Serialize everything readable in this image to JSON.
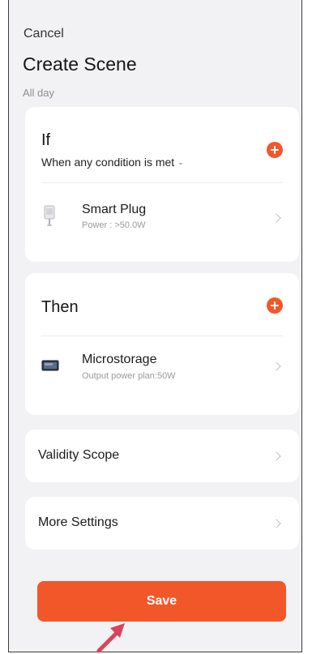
{
  "header": {
    "cancel_label": "Cancel",
    "title": "Create Scene",
    "subtitle": "All day"
  },
  "if_section": {
    "heading": "If",
    "condition_mode": "When any condition is met",
    "add_icon": "plus-circle-icon",
    "device": {
      "name": "Smart Plug",
      "detail": "Power : >50.0W",
      "icon": "smart-plug-icon"
    }
  },
  "then_section": {
    "heading": "Then",
    "add_icon": "plus-circle-icon",
    "device": {
      "name": "Microstorage",
      "detail": "Output power plan:50W",
      "icon": "microstorage-icon"
    }
  },
  "validity_scope_label": "Validity Scope",
  "more_settings_label": "More Settings",
  "save_label": "Save",
  "colors": {
    "accent": "#f2572a",
    "background": "#f2f2f4",
    "card": "#ffffff",
    "annotation_arrow": "#d9445a"
  }
}
